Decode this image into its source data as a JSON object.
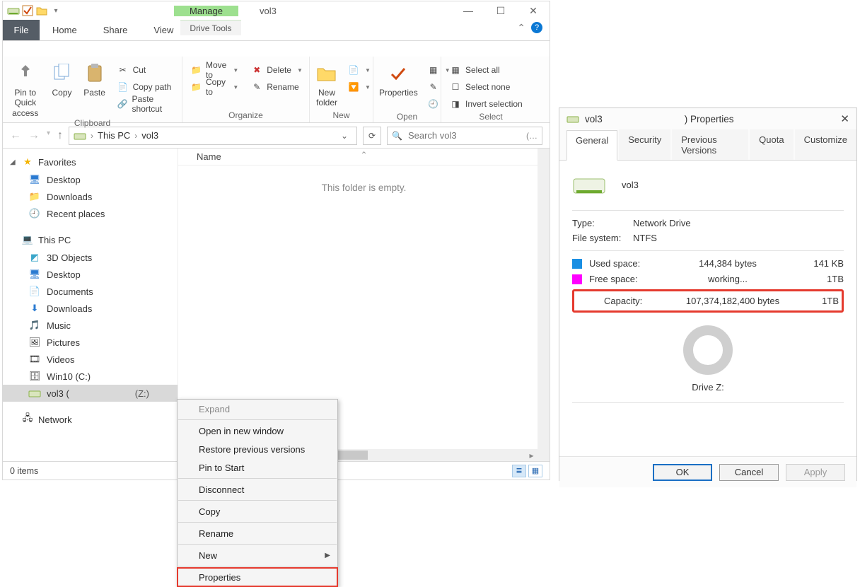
{
  "explorer": {
    "title_caption": "vol3",
    "manage_tab": "Manage",
    "drive_tools_label": "Drive Tools",
    "tabs": {
      "file": "File",
      "home": "Home",
      "share": "Share",
      "view": "View"
    },
    "ribbon": {
      "clipboard": {
        "label": "Clipboard",
        "pin": "Pin to Quick access",
        "copy": "Copy",
        "paste": "Paste",
        "cut": "Cut",
        "copy_path": "Copy path",
        "paste_shortcut": "Paste shortcut"
      },
      "organize": {
        "label": "Organize",
        "move_to": "Move to",
        "copy_to": "Copy to",
        "delete": "Delete",
        "rename": "Rename"
      },
      "new": {
        "label": "New",
        "new_folder": "New folder"
      },
      "open": {
        "label": "Open",
        "properties": "Properties"
      },
      "select": {
        "label": "Select",
        "select_all": "Select all",
        "select_none": "Select none",
        "invert": "Invert selection"
      }
    },
    "breadcrumb": {
      "this_pc": "This PC",
      "current": "vol3"
    },
    "search_placeholder": "Search vol3",
    "tree": {
      "favorites": "Favorites",
      "desktop": "Desktop",
      "downloads": "Downloads",
      "recent": "Recent places",
      "this_pc": "This PC",
      "objects3d": "3D Objects",
      "desktop2": "Desktop",
      "documents": "Documents",
      "downloads2": "Downloads",
      "music": "Music",
      "pictures": "Pictures",
      "videos": "Videos",
      "win10": "Win10 (C:)",
      "vol3": "vol3 (",
      "vol3_drive": "(Z:)",
      "network": "Network"
    },
    "content": {
      "column_name": "Name",
      "empty": "This folder is empty."
    },
    "status": {
      "items": "0 items"
    },
    "context_menu": {
      "expand": "Expand",
      "open_new": "Open in new window",
      "restore": "Restore previous versions",
      "pin_start": "Pin to Start",
      "disconnect": "Disconnect",
      "copy": "Copy",
      "rename": "Rename",
      "new": "New",
      "properties": "Properties"
    }
  },
  "props": {
    "title_suffix": ") Properties",
    "title_prefix": "vol3",
    "tabs": {
      "general": "General",
      "security": "Security",
      "previous": "Previous Versions",
      "quota": "Quota",
      "customize": "Customize"
    },
    "drive_name": "vol3",
    "type_label": "Type:",
    "type_value": "Network Drive",
    "fs_label": "File system:",
    "fs_value": "NTFS",
    "used_label": "Used space:",
    "used_bytes": "144,384 bytes",
    "used_human": "141 KB",
    "free_label": "Free space:",
    "free_bytes": "working...",
    "free_human": "1TB",
    "capacity_label": "Capacity:",
    "capacity_bytes": "107,374,182,400 bytes",
    "capacity_human": "1TB",
    "drive_letter": "Drive Z:",
    "ok": "OK",
    "cancel": "Cancel",
    "apply": "Apply"
  }
}
